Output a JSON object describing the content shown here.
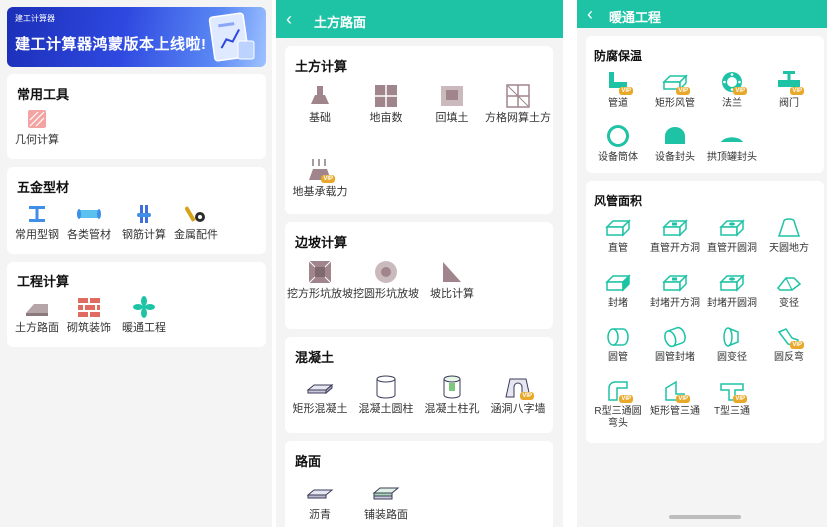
{
  "home": {
    "banner": {
      "brand": "建工计算器",
      "headline": "建工计算器鸿蒙版本上线啦!"
    },
    "sections": [
      {
        "title": "常用工具",
        "items": [
          {
            "label": "几何计算",
            "icon": "geometry-icon"
          }
        ]
      },
      {
        "title": "五金型材",
        "items": [
          {
            "label": "常用型钢",
            "icon": "i-beam-icon"
          },
          {
            "label": "各类管材",
            "icon": "pipe-icon"
          },
          {
            "label": "钢筋计算",
            "icon": "rebar-icon"
          },
          {
            "label": "金属配件",
            "icon": "fitting-icon"
          }
        ]
      },
      {
        "title": "工程计算",
        "items": [
          {
            "label": "土方路面",
            "icon": "earthwork-icon"
          },
          {
            "label": "砌筑装饰",
            "icon": "brick-icon"
          },
          {
            "label": "暖通工程",
            "icon": "fan-icon"
          }
        ]
      }
    ]
  },
  "earthwork": {
    "back": "‹",
    "title": "土方路面",
    "sections": [
      {
        "title": "土方计算",
        "items": [
          {
            "label": "基础",
            "icon": "foundation-icon"
          },
          {
            "label": "地亩数",
            "icon": "field-grid-icon"
          },
          {
            "label": "回填土",
            "icon": "backfill-icon"
          },
          {
            "label": "方格网算土方",
            "icon": "grid-method-icon"
          },
          {
            "label": "地基承载力",
            "icon": "bearing-capacity-icon",
            "vip": "VIP"
          }
        ]
      },
      {
        "title": "边坡计算",
        "items": [
          {
            "label": "挖方形坑放坡",
            "icon": "square-pit-icon"
          },
          {
            "label": "挖圆形坑放坡",
            "icon": "round-pit-icon"
          },
          {
            "label": "坡比计算",
            "icon": "slope-ratio-icon"
          }
        ]
      },
      {
        "title": "混凝土",
        "items": [
          {
            "label": "矩形混凝土",
            "icon": "rect-concrete-icon"
          },
          {
            "label": "混凝土圆柱",
            "icon": "cylinder-icon"
          },
          {
            "label": "混凝土柱孔",
            "icon": "column-hole-icon"
          },
          {
            "label": "涵洞八字墙",
            "icon": "culvert-icon",
            "vip": "VIP"
          }
        ]
      },
      {
        "title": "路面",
        "items": [
          {
            "label": "沥青",
            "icon": "asphalt-icon"
          },
          {
            "label": "铺装路面",
            "icon": "paving-icon"
          }
        ]
      }
    ]
  },
  "hvac": {
    "back": "‹",
    "title": "暖通工程",
    "sections": [
      {
        "title": "防腐保温",
        "items": [
          {
            "label": "管道",
            "icon": "pipe-elbow-icon",
            "vip": "VIP"
          },
          {
            "label": "矩形风管",
            "icon": "rect-duct-icon",
            "vip": "VIP"
          },
          {
            "label": "法兰",
            "icon": "flange-icon",
            "vip": "VIP"
          },
          {
            "label": "阀门",
            "icon": "valve-icon",
            "vip": "VIP"
          },
          {
            "label": "设备筒体",
            "icon": "ring-icon"
          },
          {
            "label": "设备封头",
            "icon": "dome-head-icon"
          },
          {
            "label": "拱顶罐封头",
            "icon": "arch-head-icon"
          }
        ]
      },
      {
        "title": "风管面积",
        "items": [
          {
            "label": "直管",
            "icon": "straight-duct-icon"
          },
          {
            "label": "直管开方洞",
            "icon": "duct-square-hole-icon"
          },
          {
            "label": "直管开圆洞",
            "icon": "duct-round-hole-icon"
          },
          {
            "label": "天圆地方",
            "icon": "transition-icon"
          },
          {
            "label": "封堵",
            "icon": "cap-icon"
          },
          {
            "label": "封堵开方洞",
            "icon": "cap-square-hole-icon"
          },
          {
            "label": "封堵开圆洞",
            "icon": "cap-round-hole-icon"
          },
          {
            "label": "变径",
            "icon": "reducer-icon"
          },
          {
            "label": "圆管",
            "icon": "round-pipe-icon"
          },
          {
            "label": "圆管封堵",
            "icon": "round-cap-icon"
          },
          {
            "label": "圆变径",
            "icon": "round-reducer-icon"
          },
          {
            "label": "圆反弯",
            "icon": "round-offset-icon",
            "vip": "VIP"
          },
          {
            "label": "R型三通圆弯头",
            "icon": "r-tee-icon",
            "vip": "VIP"
          },
          {
            "label": "矩形管三通",
            "icon": "rect-tee-icon",
            "vip": "VIP"
          },
          {
            "label": "T型三通",
            "icon": "t-tee-icon",
            "vip": "VIP"
          }
        ]
      }
    ]
  },
  "colors": {
    "accent": "#1ec3a5",
    "vip": "#e8a92a",
    "icon_teal": "#1ec3a5",
    "icon_mauve": "#a0868c"
  }
}
